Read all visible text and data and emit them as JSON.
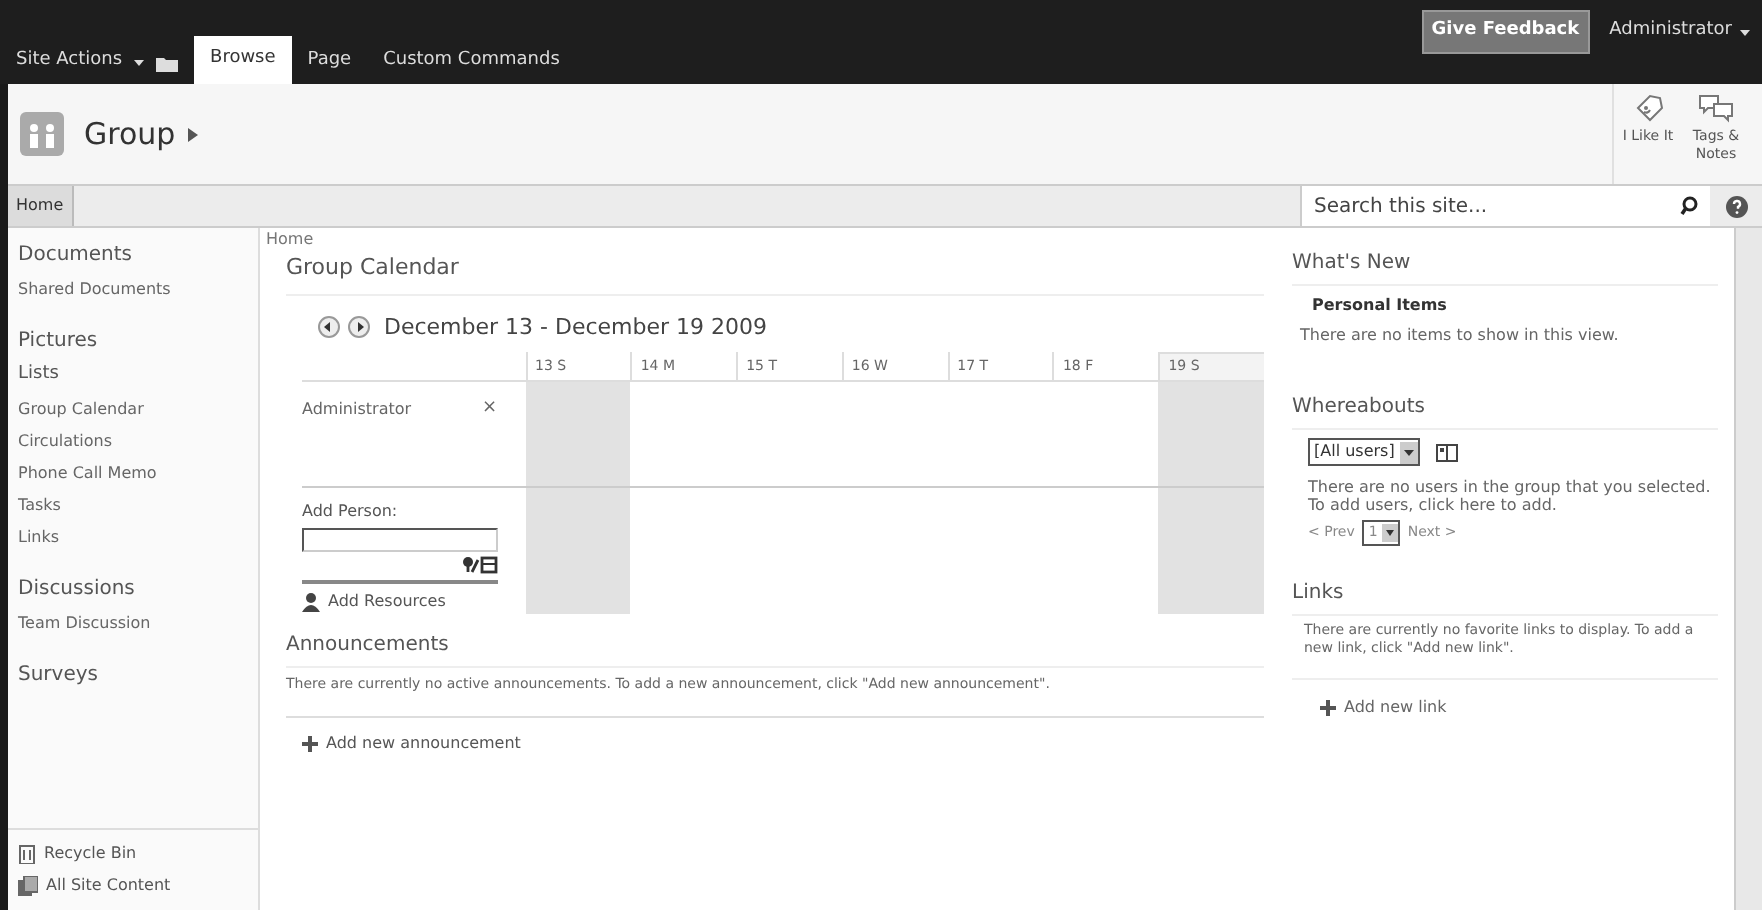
{
  "top_bar": {
    "site_actions": "Site Actions",
    "tabs": [
      {
        "label": "Browse",
        "selected": true
      },
      {
        "label": "Page",
        "selected": false
      },
      {
        "label": "Custom Commands",
        "selected": false
      }
    ],
    "feedback": "Give Feedback",
    "user": "Administrator"
  },
  "header": {
    "site_title": "Group",
    "actions": [
      {
        "kind": "like",
        "label": "I Like It"
      },
      {
        "kind": "tags",
        "label": "Tags & Notes"
      }
    ]
  },
  "nav": {
    "tabs": [
      {
        "label": "Home",
        "selected": true
      }
    ],
    "search": {
      "placeholder": "Search this site..."
    }
  },
  "sidebar": {
    "items": [
      {
        "kind": "heading",
        "label": "Documents"
      },
      {
        "kind": "link",
        "label": "Shared Documents"
      },
      {
        "kind": "heading",
        "label": "Pictures"
      },
      {
        "kind": "heading2",
        "label": "Lists"
      },
      {
        "kind": "link",
        "label": "Group Calendar"
      },
      {
        "kind": "link",
        "label": "Circulations"
      },
      {
        "kind": "link",
        "label": "Phone Call Memo"
      },
      {
        "kind": "link",
        "label": "Tasks"
      },
      {
        "kind": "link",
        "label": "Links"
      },
      {
        "kind": "heading",
        "label": "Discussions"
      },
      {
        "kind": "link",
        "label": "Team Discussion"
      },
      {
        "kind": "heading",
        "label": "Surveys"
      }
    ],
    "footer": [
      {
        "kind": "recycle",
        "label": "Recycle Bin"
      },
      {
        "kind": "content",
        "label": "All Site Content"
      }
    ]
  },
  "breadcrumb": "Home",
  "calendar": {
    "title": "Group Calendar",
    "range": "December 13 - December 19 2009",
    "days": [
      {
        "label": "13 S",
        "weekend": true,
        "today": false
      },
      {
        "label": "14 M",
        "weekend": false,
        "today": false
      },
      {
        "label": "15 T",
        "weekend": false,
        "today": false
      },
      {
        "label": "16 W",
        "weekend": false,
        "today": false
      },
      {
        "label": "17 T",
        "weekend": false,
        "today": false
      },
      {
        "label": "18 F",
        "weekend": false,
        "today": false
      },
      {
        "label": "19 S",
        "weekend": true,
        "today": true
      }
    ],
    "people": [
      {
        "name": "Administrator",
        "remove": "×"
      }
    ],
    "add_person": "Add Person:",
    "add_resources": "Add Resources"
  },
  "announcements": {
    "title": "Announcements",
    "empty": "There are currently no active announcements. To add a new announcement, click \"Add new announcement\".",
    "add": "Add new announcement"
  },
  "whats_new": {
    "title": "What's New",
    "subtitle": "Personal Items",
    "empty": "There are no items to show in this view."
  },
  "whereabouts": {
    "title": "Whereabouts",
    "filter": "[All users]",
    "empty": "There are no users in the group that you selected. To add users, click here to add.",
    "prev": "< Prev",
    "page": "1",
    "next": "Next >"
  },
  "links": {
    "title": "Links",
    "empty": "There are currently no favorite links to display. To add a new link, click \"Add new link\".",
    "add": "Add new link"
  }
}
